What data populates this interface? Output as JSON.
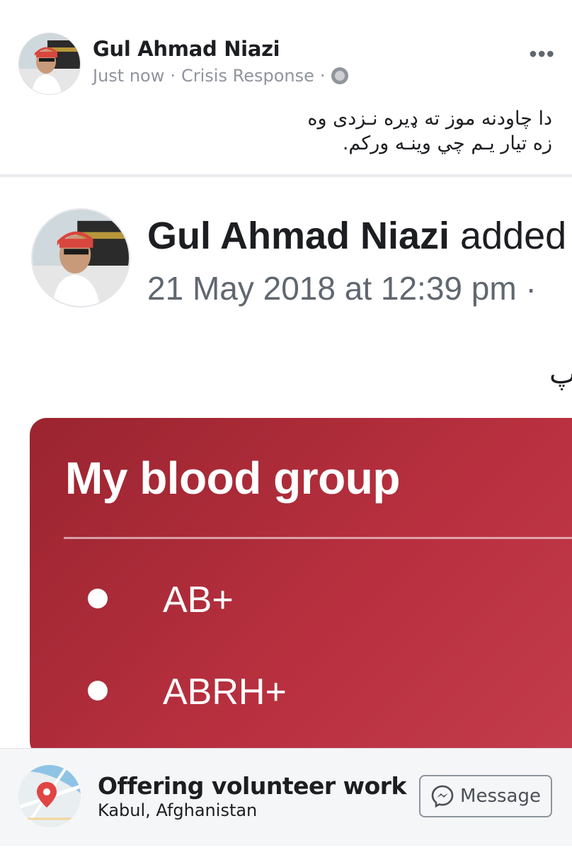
{
  "post": {
    "author": "Gul Ahmad Niazi",
    "time": "Just now",
    "separator": "·",
    "category": "Crisis Response",
    "more_icon": "more-horizontal-icon",
    "privacy_icon": "globe-icon",
    "text_line1": "دا چاودنه موز ته ډیره نـزدی وه",
    "text_line2": "زه تیار یـم چي وینـه ورکم."
  },
  "shared": {
    "author": "Gul Ahmad Niazi",
    "action": " added",
    "date": "21 May 2018 at 12:39 pm ·",
    "glyph": "پ",
    "card": {
      "title": "My blood group",
      "items": [
        "AB+",
        "ABRH+"
      ],
      "color": "#b02c3b"
    }
  },
  "footer": {
    "title": "Offering volunteer work",
    "location": "Kabul, Afghanistan",
    "button_label": "Message",
    "map_icon": "map-pin-icon",
    "messenger_icon": "messenger-icon"
  },
  "colors": {
    "text": "#1c1e21",
    "meta": "#90949c",
    "card_start": "#9a2430",
    "card_end": "#c43d4d"
  }
}
